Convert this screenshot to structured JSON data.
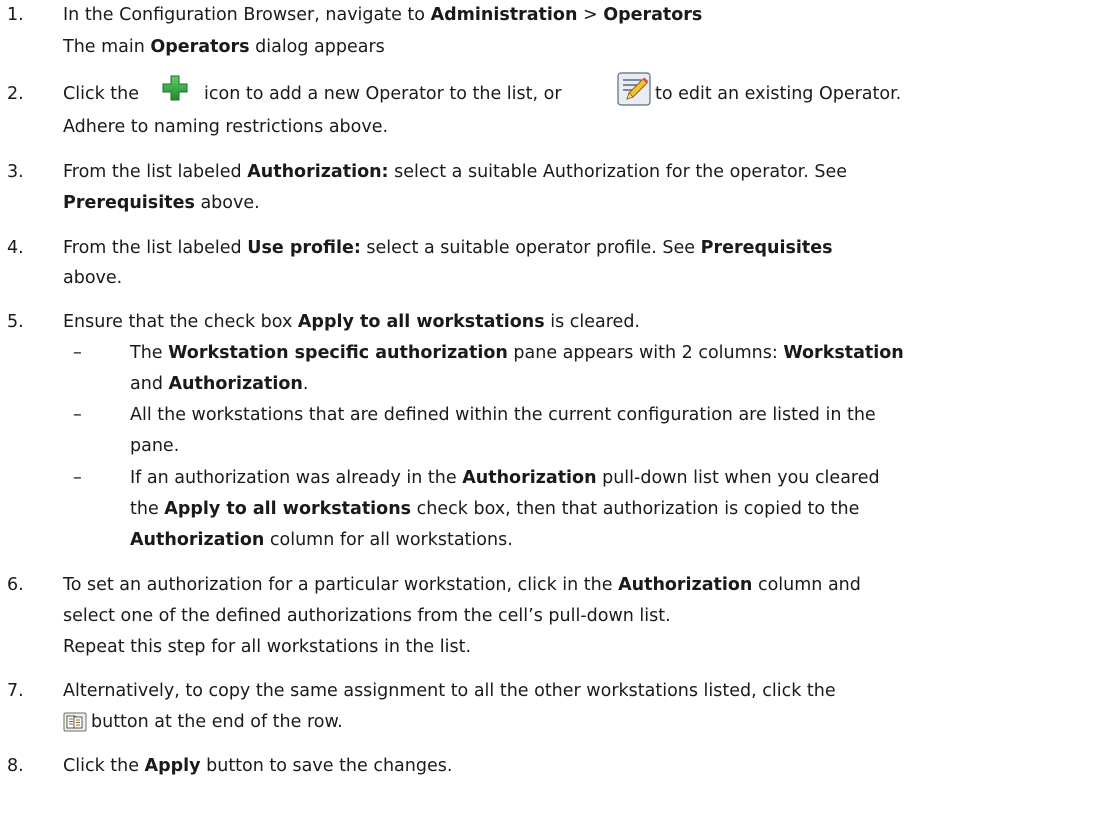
{
  "steps": [
    {
      "num": "1.",
      "l1_a": "In the Configuration Browser, navigate to ",
      "l1_b": "Administration",
      "l1_c": " > ",
      "l1_d": "Operators",
      "l2_a": "The main ",
      "l2_b": "Operators",
      "l2_c": " dialog appears"
    },
    {
      "num": "2.",
      "l1_a": "Click the",
      "l1_b": "icon to add a new Operator to the list, or",
      "l1_c": "to edit an existing Operator.",
      "l2": "Adhere to naming restrictions above."
    },
    {
      "num": "3.",
      "l1_a": "From the list labeled ",
      "l1_b": "Authorization:",
      "l1_c": " select a suitable Authorization for the operator. See",
      "l2_a": "Prerequisites",
      "l2_b": " above."
    },
    {
      "num": "4.",
      "l1_a": "From the list labeled ",
      "l1_b": "Use profile:",
      "l1_c": " select a suitable operator profile. See ",
      "l1_d": "Prerequisites",
      "l2": "above."
    },
    {
      "num": "5.",
      "l1_a": "Ensure that the check box ",
      "l1_b": "Apply to all workstations",
      "l1_c": " is cleared.",
      "bullets": [
        {
          "l1_a": "The ",
          "l1_b": "Workstation specific authorization",
          "l1_c": " pane appears with 2 columns: ",
          "l1_d": "Workstation",
          "l2_a": "and ",
          "l2_b": "Authorization",
          "l2_c": "."
        },
        {
          "l1": "All the workstations that are defined within the current configuration are listed in the",
          "l2": "pane."
        },
        {
          "l1_a": "If an authorization was already in the ",
          "l1_b": "Authorization",
          "l1_c": " pull-down list when you cleared",
          "l2_a": "the ",
          "l2_b": "Apply to all workstations",
          "l2_c": " check box, then that authorization is copied to the",
          "l3_a": "Authorization",
          "l3_b": " column for all workstations."
        }
      ]
    },
    {
      "num": "6.",
      "l1_a": "To set an authorization for a particular workstation, click in the ",
      "l1_b": "Authorization",
      "l1_c": " column and",
      "l2": "select one of the defined authorizations from the cell’s pull-down list.",
      "l3": "Repeat this step for all workstations in the list."
    },
    {
      "num": "7.",
      "l1": "Alternatively, to copy the same assignment to all the other workstations listed, click the",
      "l2": "button at the end of the row."
    },
    {
      "num": "8.",
      "l1_a": "Click the ",
      "l1_b": "Apply",
      "l1_c": " button to save the changes."
    }
  ],
  "dash": "–",
  "icons": {
    "add": "plus-icon",
    "edit": "edit-pencil-icon",
    "copy": "copy-to-all-icon"
  },
  "colors": {
    "plus": "#2e9a3e",
    "text": "#1a1a1a"
  }
}
